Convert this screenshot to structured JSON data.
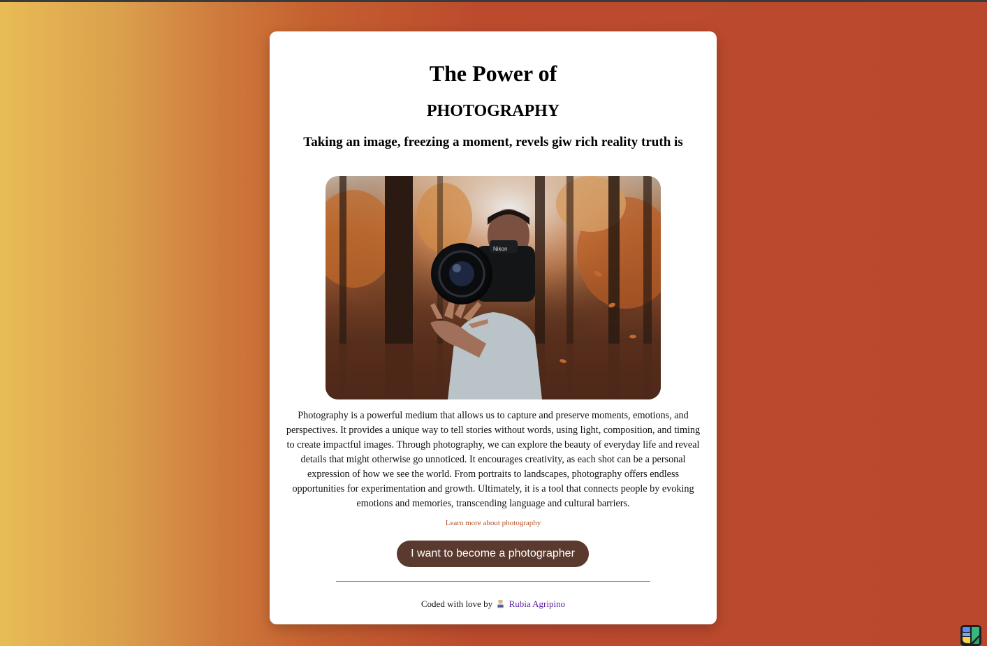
{
  "page": {
    "title": "The Power of",
    "subtitle": "PHOTOGRAPHY",
    "tagline": "Taking an image, freezing a moment, revels giw rich reality truth is"
  },
  "image": {
    "alt": "Person tossing a Nikon camera in an autumn forest",
    "camera_brand": "Nikon"
  },
  "body": {
    "paragraph": "Photography is a powerful medium that allows us to capture and preserve moments, emotions, and perspectives. It provides a unique way to tell stories without words, using light, composition, and timing to create impactful images. Through photography, we can explore the beauty of everyday life and reveal details that might otherwise go unnoticed. It encourages creativity, as each shot can be a personal expression of how we see the world. From portraits to landscapes, photography offers endless opportunities for experimentation and growth. Ultimately, it is a tool that connects people by evoking emotions and memories, transcending language and cultural barriers."
  },
  "links": {
    "learn_more": "Learn more about photography"
  },
  "cta": {
    "label": "I want to become a photographer"
  },
  "footer": {
    "prefix": "Coded with love by",
    "emoji_icon": "woman-technologist-icon",
    "author": "Rubia Agripino"
  },
  "colors": {
    "background_left": "#e8bc55",
    "background_right": "#b9482d",
    "card": "#ffffff",
    "button": "#5a3a2e",
    "link": "#b4512a",
    "author_link": "#5a1f9e"
  }
}
